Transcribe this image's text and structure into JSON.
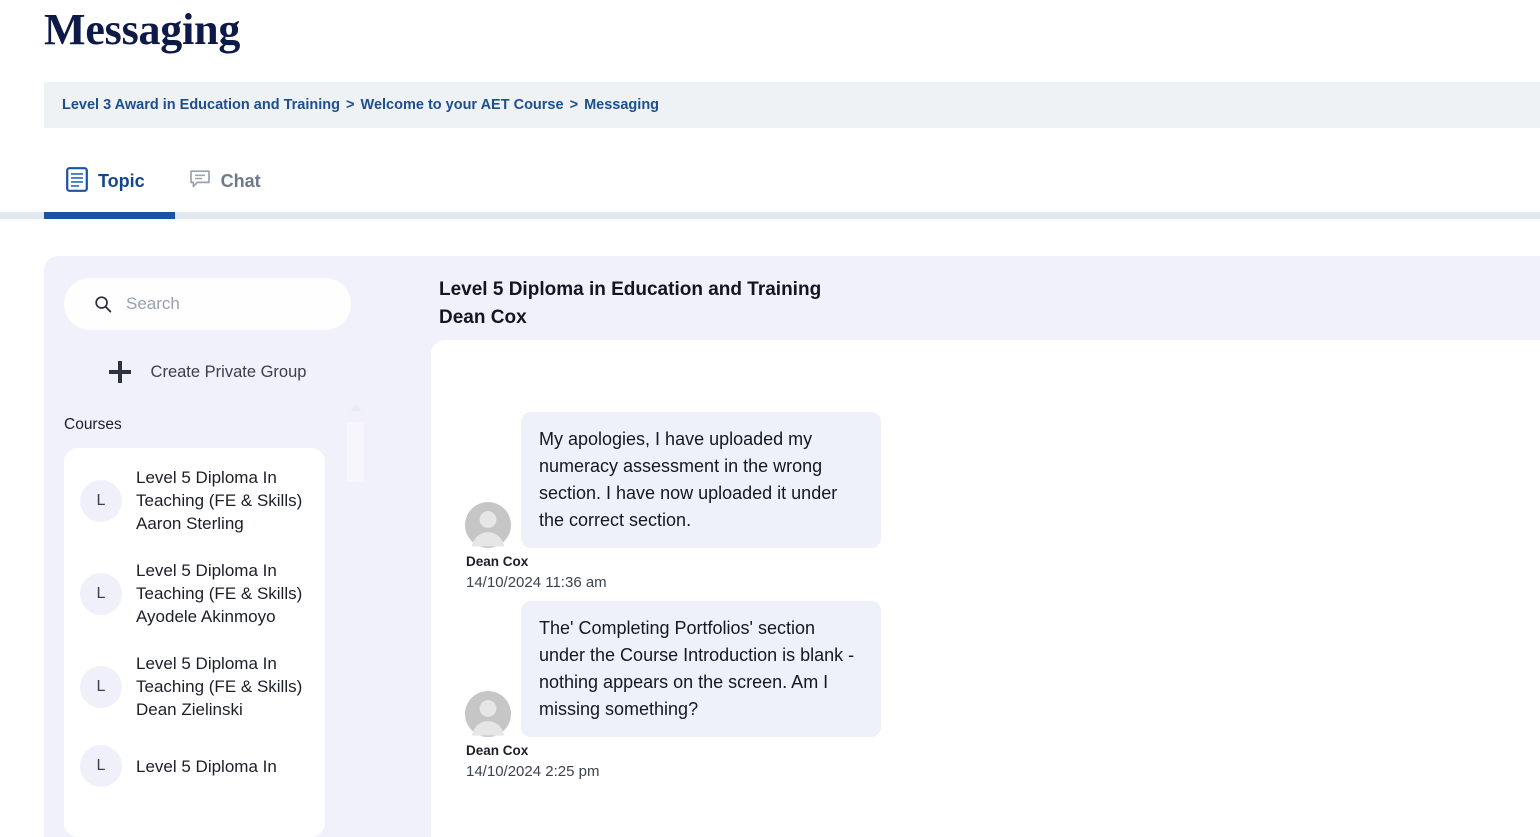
{
  "page": {
    "title": "Messaging"
  },
  "breadcrumb": {
    "items": [
      "Level 3 Award in Education and Training",
      "Welcome to your AET Course",
      "Messaging"
    ],
    "separator": ">"
  },
  "tabs": [
    {
      "label": "Topic",
      "icon": "document-icon",
      "active": true
    },
    {
      "label": "Chat",
      "icon": "chat-bubble-icon",
      "active": false
    }
  ],
  "sidebar": {
    "search": {
      "placeholder": "Search",
      "value": "",
      "icon": "search-icon"
    },
    "create_group": {
      "label": "Create Private Group",
      "icon": "plus-icon"
    },
    "section_label": "Courses",
    "courses": [
      {
        "avatar_initial": "L",
        "name": "Level 5 Diploma In Teaching (FE & Skills)",
        "person": "Aaron Sterling"
      },
      {
        "avatar_initial": "L",
        "name": "Level 5 Diploma In Teaching (FE & Skills)",
        "person": "Ayodele Akinmoyo"
      },
      {
        "avatar_initial": "L",
        "name": "Level 5 Diploma In Teaching (FE & Skills)",
        "person": "Dean Zielinski"
      },
      {
        "avatar_initial": "L",
        "name": "Level 5 Diploma In",
        "person": ""
      }
    ]
  },
  "conversation": {
    "course_title": "Level 5 Diploma in Education and Training",
    "participant": "Dean Cox",
    "messages": [
      {
        "text": "My apologies, I have uploaded my numeracy assessment in the wrong section. I have now uploaded it under the correct section.",
        "sender": "Dean Cox",
        "timestamp": "14/10/2024 11:36 am",
        "avatar": "user-avatar-icon"
      },
      {
        "text": "The' Completing Portfolios' section under the Course Introduction is blank - nothing appears on the screen. Am I missing something?",
        "sender": "Dean Cox",
        "timestamp": "14/10/2024 2:25 pm",
        "avatar": "user-avatar-icon"
      }
    ]
  },
  "colors": {
    "title": "#0d1946",
    "breadcrumb_text": "#1d4e8f",
    "breadcrumb_bg": "#eef2f5",
    "tab_active": "#14468c",
    "tab_inactive": "#6e7a8a",
    "tab_underline": "#1d51a3",
    "panel_bg": "#f1f1fb",
    "bubble_bg": "#eef0fa",
    "card_bg": "#ffffff"
  }
}
